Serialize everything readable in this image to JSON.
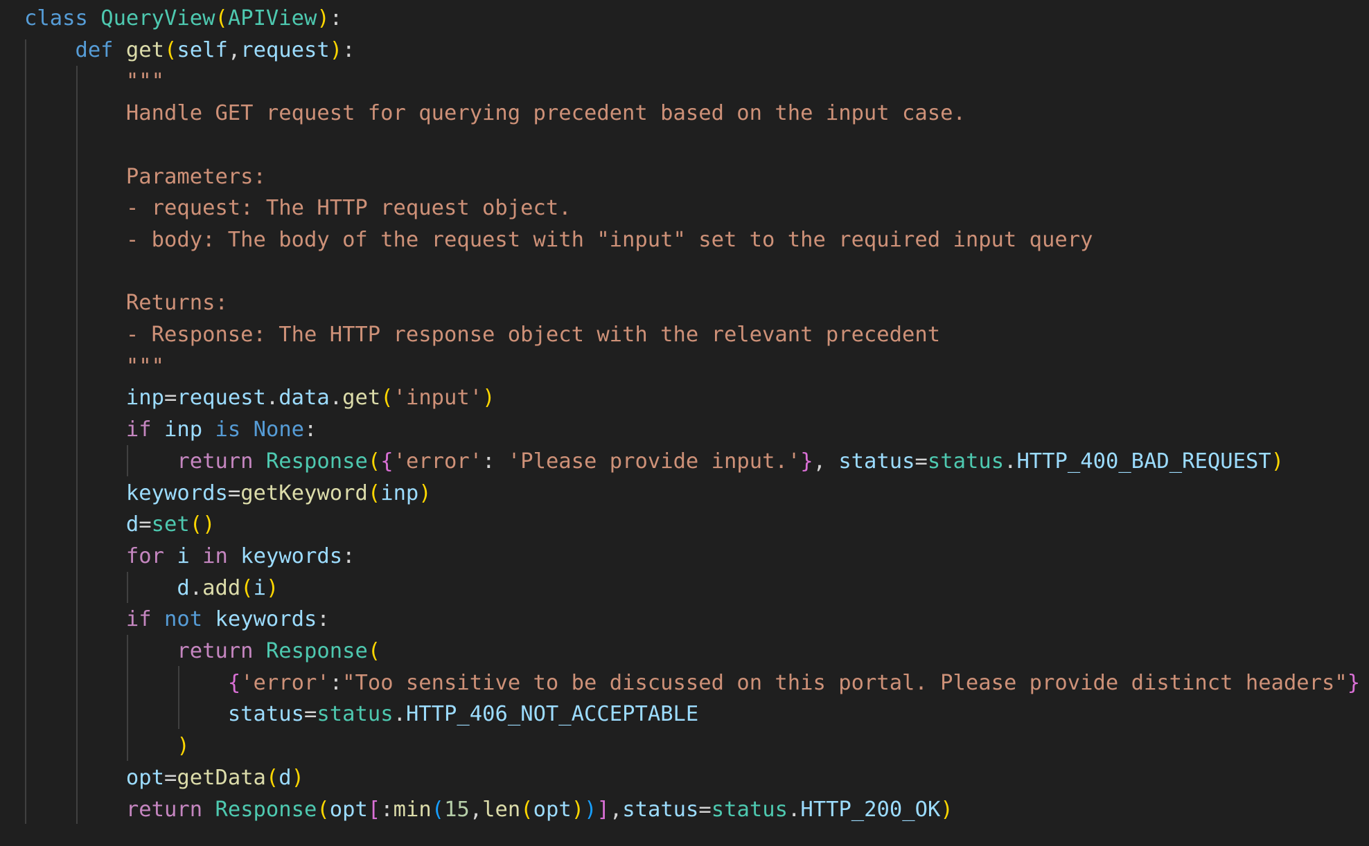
{
  "theme": {
    "background": "#1f1f1f",
    "keyword": "#569cd6",
    "control_keyword": "#c586c0",
    "class_name": "#4ec9b0",
    "function": "#dcdcaa",
    "variable": "#9cdcfe",
    "string": "#ce9178",
    "number": "#b5cea8",
    "punctuation": "#d4d4d4",
    "bracket_level_1": "#ffd700",
    "bracket_level_2": "#da70d6",
    "bracket_level_3": "#179fff",
    "indent_guide": "#404040"
  },
  "lines": [
    [
      {
        "t": "class",
        "c": "kw"
      },
      {
        "t": " ",
        "c": "punc"
      },
      {
        "t": "QueryView",
        "c": "cls"
      },
      {
        "t": "(",
        "c": "br1"
      },
      {
        "t": "APIView",
        "c": "cls"
      },
      {
        "t": ")",
        "c": "br1"
      },
      {
        "t": ":",
        "c": "punc"
      }
    ],
    [
      {
        "t": "    ",
        "c": "punc"
      },
      {
        "t": "def",
        "c": "kw"
      },
      {
        "t": " ",
        "c": "punc"
      },
      {
        "t": "get",
        "c": "fn"
      },
      {
        "t": "(",
        "c": "br1"
      },
      {
        "t": "self",
        "c": "var"
      },
      {
        "t": ",",
        "c": "punc"
      },
      {
        "t": "request",
        "c": "var"
      },
      {
        "t": ")",
        "c": "br1"
      },
      {
        "t": ":",
        "c": "punc"
      }
    ],
    [
      {
        "t": "        \"\"\"",
        "c": "str"
      }
    ],
    [
      {
        "t": "        Handle GET request for querying precedent based on the input case.",
        "c": "str"
      }
    ],
    [],
    [
      {
        "t": "        Parameters:",
        "c": "str"
      }
    ],
    [
      {
        "t": "        - request: The HTTP request object.",
        "c": "str"
      }
    ],
    [
      {
        "t": "        - body: The body of the request with \"input\" set to the required input query",
        "c": "str"
      }
    ],
    [],
    [
      {
        "t": "        Returns:",
        "c": "str"
      }
    ],
    [
      {
        "t": "        - Response: The HTTP response object with the relevant precedent",
        "c": "str"
      }
    ],
    [
      {
        "t": "        \"\"\"",
        "c": "str"
      }
    ],
    [
      {
        "t": "        ",
        "c": "punc"
      },
      {
        "t": "inp",
        "c": "var"
      },
      {
        "t": "=",
        "c": "punc"
      },
      {
        "t": "request",
        "c": "var"
      },
      {
        "t": ".",
        "c": "punc"
      },
      {
        "t": "data",
        "c": "var"
      },
      {
        "t": ".",
        "c": "punc"
      },
      {
        "t": "get",
        "c": "fn"
      },
      {
        "t": "(",
        "c": "br1"
      },
      {
        "t": "'input'",
        "c": "str"
      },
      {
        "t": ")",
        "c": "br1"
      }
    ],
    [
      {
        "t": "        ",
        "c": "punc"
      },
      {
        "t": "if",
        "c": "ctrl"
      },
      {
        "t": " ",
        "c": "punc"
      },
      {
        "t": "inp",
        "c": "var"
      },
      {
        "t": " ",
        "c": "punc"
      },
      {
        "t": "is",
        "c": "kw"
      },
      {
        "t": " ",
        "c": "punc"
      },
      {
        "t": "None",
        "c": "kw"
      },
      {
        "t": ":",
        "c": "punc"
      }
    ],
    [
      {
        "t": "            ",
        "c": "punc"
      },
      {
        "t": "return",
        "c": "ctrl"
      },
      {
        "t": " ",
        "c": "punc"
      },
      {
        "t": "Response",
        "c": "cls"
      },
      {
        "t": "(",
        "c": "br1"
      },
      {
        "t": "{",
        "c": "br2"
      },
      {
        "t": "'error'",
        "c": "str"
      },
      {
        "t": ": ",
        "c": "punc"
      },
      {
        "t": "'Please provide input.'",
        "c": "str"
      },
      {
        "t": "}",
        "c": "br2"
      },
      {
        "t": ", ",
        "c": "punc"
      },
      {
        "t": "status",
        "c": "var"
      },
      {
        "t": "=",
        "c": "punc"
      },
      {
        "t": "status",
        "c": "cls"
      },
      {
        "t": ".",
        "c": "punc"
      },
      {
        "t": "HTTP_400_BAD_REQUEST",
        "c": "var"
      },
      {
        "t": ")",
        "c": "br1"
      }
    ],
    [
      {
        "t": "        ",
        "c": "punc"
      },
      {
        "t": "keywords",
        "c": "var"
      },
      {
        "t": "=",
        "c": "punc"
      },
      {
        "t": "getKeyword",
        "c": "fn"
      },
      {
        "t": "(",
        "c": "br1"
      },
      {
        "t": "inp",
        "c": "var"
      },
      {
        "t": ")",
        "c": "br1"
      }
    ],
    [
      {
        "t": "        ",
        "c": "punc"
      },
      {
        "t": "d",
        "c": "var"
      },
      {
        "t": "=",
        "c": "punc"
      },
      {
        "t": "set",
        "c": "cls"
      },
      {
        "t": "()",
        "c": "br1"
      }
    ],
    [
      {
        "t": "        ",
        "c": "punc"
      },
      {
        "t": "for",
        "c": "ctrl"
      },
      {
        "t": " ",
        "c": "punc"
      },
      {
        "t": "i",
        "c": "var"
      },
      {
        "t": " ",
        "c": "punc"
      },
      {
        "t": "in",
        "c": "ctrl"
      },
      {
        "t": " ",
        "c": "punc"
      },
      {
        "t": "keywords",
        "c": "var"
      },
      {
        "t": ":",
        "c": "punc"
      }
    ],
    [
      {
        "t": "            ",
        "c": "punc"
      },
      {
        "t": "d",
        "c": "var"
      },
      {
        "t": ".",
        "c": "punc"
      },
      {
        "t": "add",
        "c": "fn"
      },
      {
        "t": "(",
        "c": "br1"
      },
      {
        "t": "i",
        "c": "var"
      },
      {
        "t": ")",
        "c": "br1"
      }
    ],
    [
      {
        "t": "        ",
        "c": "punc"
      },
      {
        "t": "if",
        "c": "ctrl"
      },
      {
        "t": " ",
        "c": "punc"
      },
      {
        "t": "not",
        "c": "kw"
      },
      {
        "t": " ",
        "c": "punc"
      },
      {
        "t": "keywords",
        "c": "var"
      },
      {
        "t": ":",
        "c": "punc"
      }
    ],
    [
      {
        "t": "            ",
        "c": "punc"
      },
      {
        "t": "return",
        "c": "ctrl"
      },
      {
        "t": " ",
        "c": "punc"
      },
      {
        "t": "Response",
        "c": "cls"
      },
      {
        "t": "(",
        "c": "br1"
      }
    ],
    [
      {
        "t": "                ",
        "c": "punc"
      },
      {
        "t": "{",
        "c": "br2"
      },
      {
        "t": "'error'",
        "c": "str"
      },
      {
        "t": ":",
        "c": "punc"
      },
      {
        "t": "\"Too sensitive to be discussed on this portal. Please provide distinct headers\"",
        "c": "str"
      },
      {
        "t": "}",
        "c": "br2"
      }
    ],
    [
      {
        "t": "                ",
        "c": "punc"
      },
      {
        "t": "status",
        "c": "var"
      },
      {
        "t": "=",
        "c": "punc"
      },
      {
        "t": "status",
        "c": "cls"
      },
      {
        "t": ".",
        "c": "punc"
      },
      {
        "t": "HTTP_406_NOT_ACCEPTABLE",
        "c": "var"
      }
    ],
    [
      {
        "t": "            ",
        "c": "punc"
      },
      {
        "t": ")",
        "c": "br1"
      }
    ],
    [
      {
        "t": "        ",
        "c": "punc"
      },
      {
        "t": "opt",
        "c": "var"
      },
      {
        "t": "=",
        "c": "punc"
      },
      {
        "t": "getData",
        "c": "fn"
      },
      {
        "t": "(",
        "c": "br1"
      },
      {
        "t": "d",
        "c": "var"
      },
      {
        "t": ")",
        "c": "br1"
      }
    ],
    [
      {
        "t": "        ",
        "c": "punc"
      },
      {
        "t": "return",
        "c": "ctrl"
      },
      {
        "t": " ",
        "c": "punc"
      },
      {
        "t": "Response",
        "c": "cls"
      },
      {
        "t": "(",
        "c": "br1"
      },
      {
        "t": "opt",
        "c": "var"
      },
      {
        "t": "[",
        "c": "br2"
      },
      {
        "t": ":",
        "c": "punc"
      },
      {
        "t": "min",
        "c": "fn"
      },
      {
        "t": "(",
        "c": "br3"
      },
      {
        "t": "15",
        "c": "num"
      },
      {
        "t": ",",
        "c": "punc"
      },
      {
        "t": "len",
        "c": "fn"
      },
      {
        "t": "(",
        "c": "br1"
      },
      {
        "t": "opt",
        "c": "var"
      },
      {
        "t": ")",
        "c": "br1"
      },
      {
        "t": ")",
        "c": "br3"
      },
      {
        "t": "]",
        "c": "br2"
      },
      {
        "t": ",",
        "c": "punc"
      },
      {
        "t": "status",
        "c": "var"
      },
      {
        "t": "=",
        "c": "punc"
      },
      {
        "t": "status",
        "c": "cls"
      },
      {
        "t": ".",
        "c": "punc"
      },
      {
        "t": "HTTP_200_OK",
        "c": "var"
      },
      {
        "t": ")",
        "c": "br1"
      }
    ]
  ]
}
